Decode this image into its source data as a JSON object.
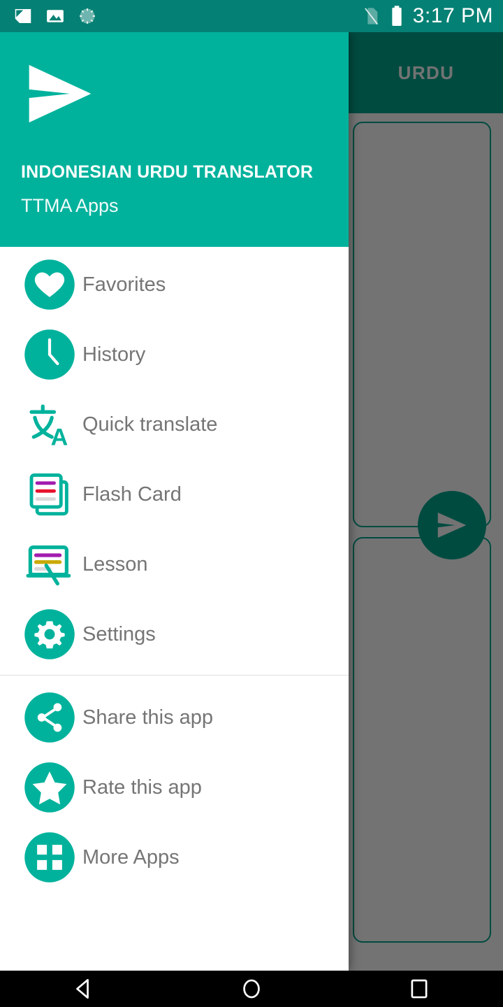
{
  "status_bar": {
    "left_icons": [
      {
        "name": "screenshot-icon"
      },
      {
        "name": "image-icon"
      },
      {
        "name": "sync-spinner-icon"
      }
    ],
    "right_icons": [
      {
        "name": "no-sim-icon"
      },
      {
        "name": "battery-full-icon"
      }
    ],
    "clock": "3:17 PM",
    "background_color": "#058074"
  },
  "app_bar": {
    "background_color": "#00a78f",
    "tabs": [
      {
        "label": "URDU",
        "selected": true
      }
    ]
  },
  "content": {
    "input_card": {
      "name": "input-text-card"
    },
    "output_card": {
      "name": "output-text-card"
    },
    "fab": {
      "name": "translate-send-fab",
      "icon": "send-icon",
      "color": "#00a78f"
    },
    "scrim_color": "#666666"
  },
  "drawer": {
    "header": {
      "logo_icon": "send-icon",
      "title": "INDONESIAN URDU TRANSLATOR",
      "subtitle": "TTMA Apps",
      "background_color": "#00b29c"
    },
    "primary_items": [
      {
        "label": "Favorites",
        "icon": "heart-icon"
      },
      {
        "label": "History",
        "icon": "clock-icon"
      },
      {
        "label": "Quick translate",
        "icon": "translate-icon"
      },
      {
        "label": "Flash Card",
        "icon": "flash-card-icon"
      },
      {
        "label": "Lesson",
        "icon": "lesson-board-icon"
      },
      {
        "label": "Settings",
        "icon": "gear-icon"
      }
    ],
    "secondary_items": [
      {
        "label": "Share this app",
        "icon": "share-icon"
      },
      {
        "label": "Rate this app",
        "icon": "star-icon"
      },
      {
        "label": "More Apps",
        "icon": "grid-apps-icon"
      }
    ],
    "accent_color": "#00b29c",
    "label_color": "#757575"
  },
  "nav_bar": {
    "buttons": [
      {
        "name": "back-button",
        "icon": "triangle-back-icon"
      },
      {
        "name": "home-button",
        "icon": "circle-home-icon"
      },
      {
        "name": "recents-button",
        "icon": "square-recents-icon"
      }
    ],
    "background_color": "#000000"
  }
}
